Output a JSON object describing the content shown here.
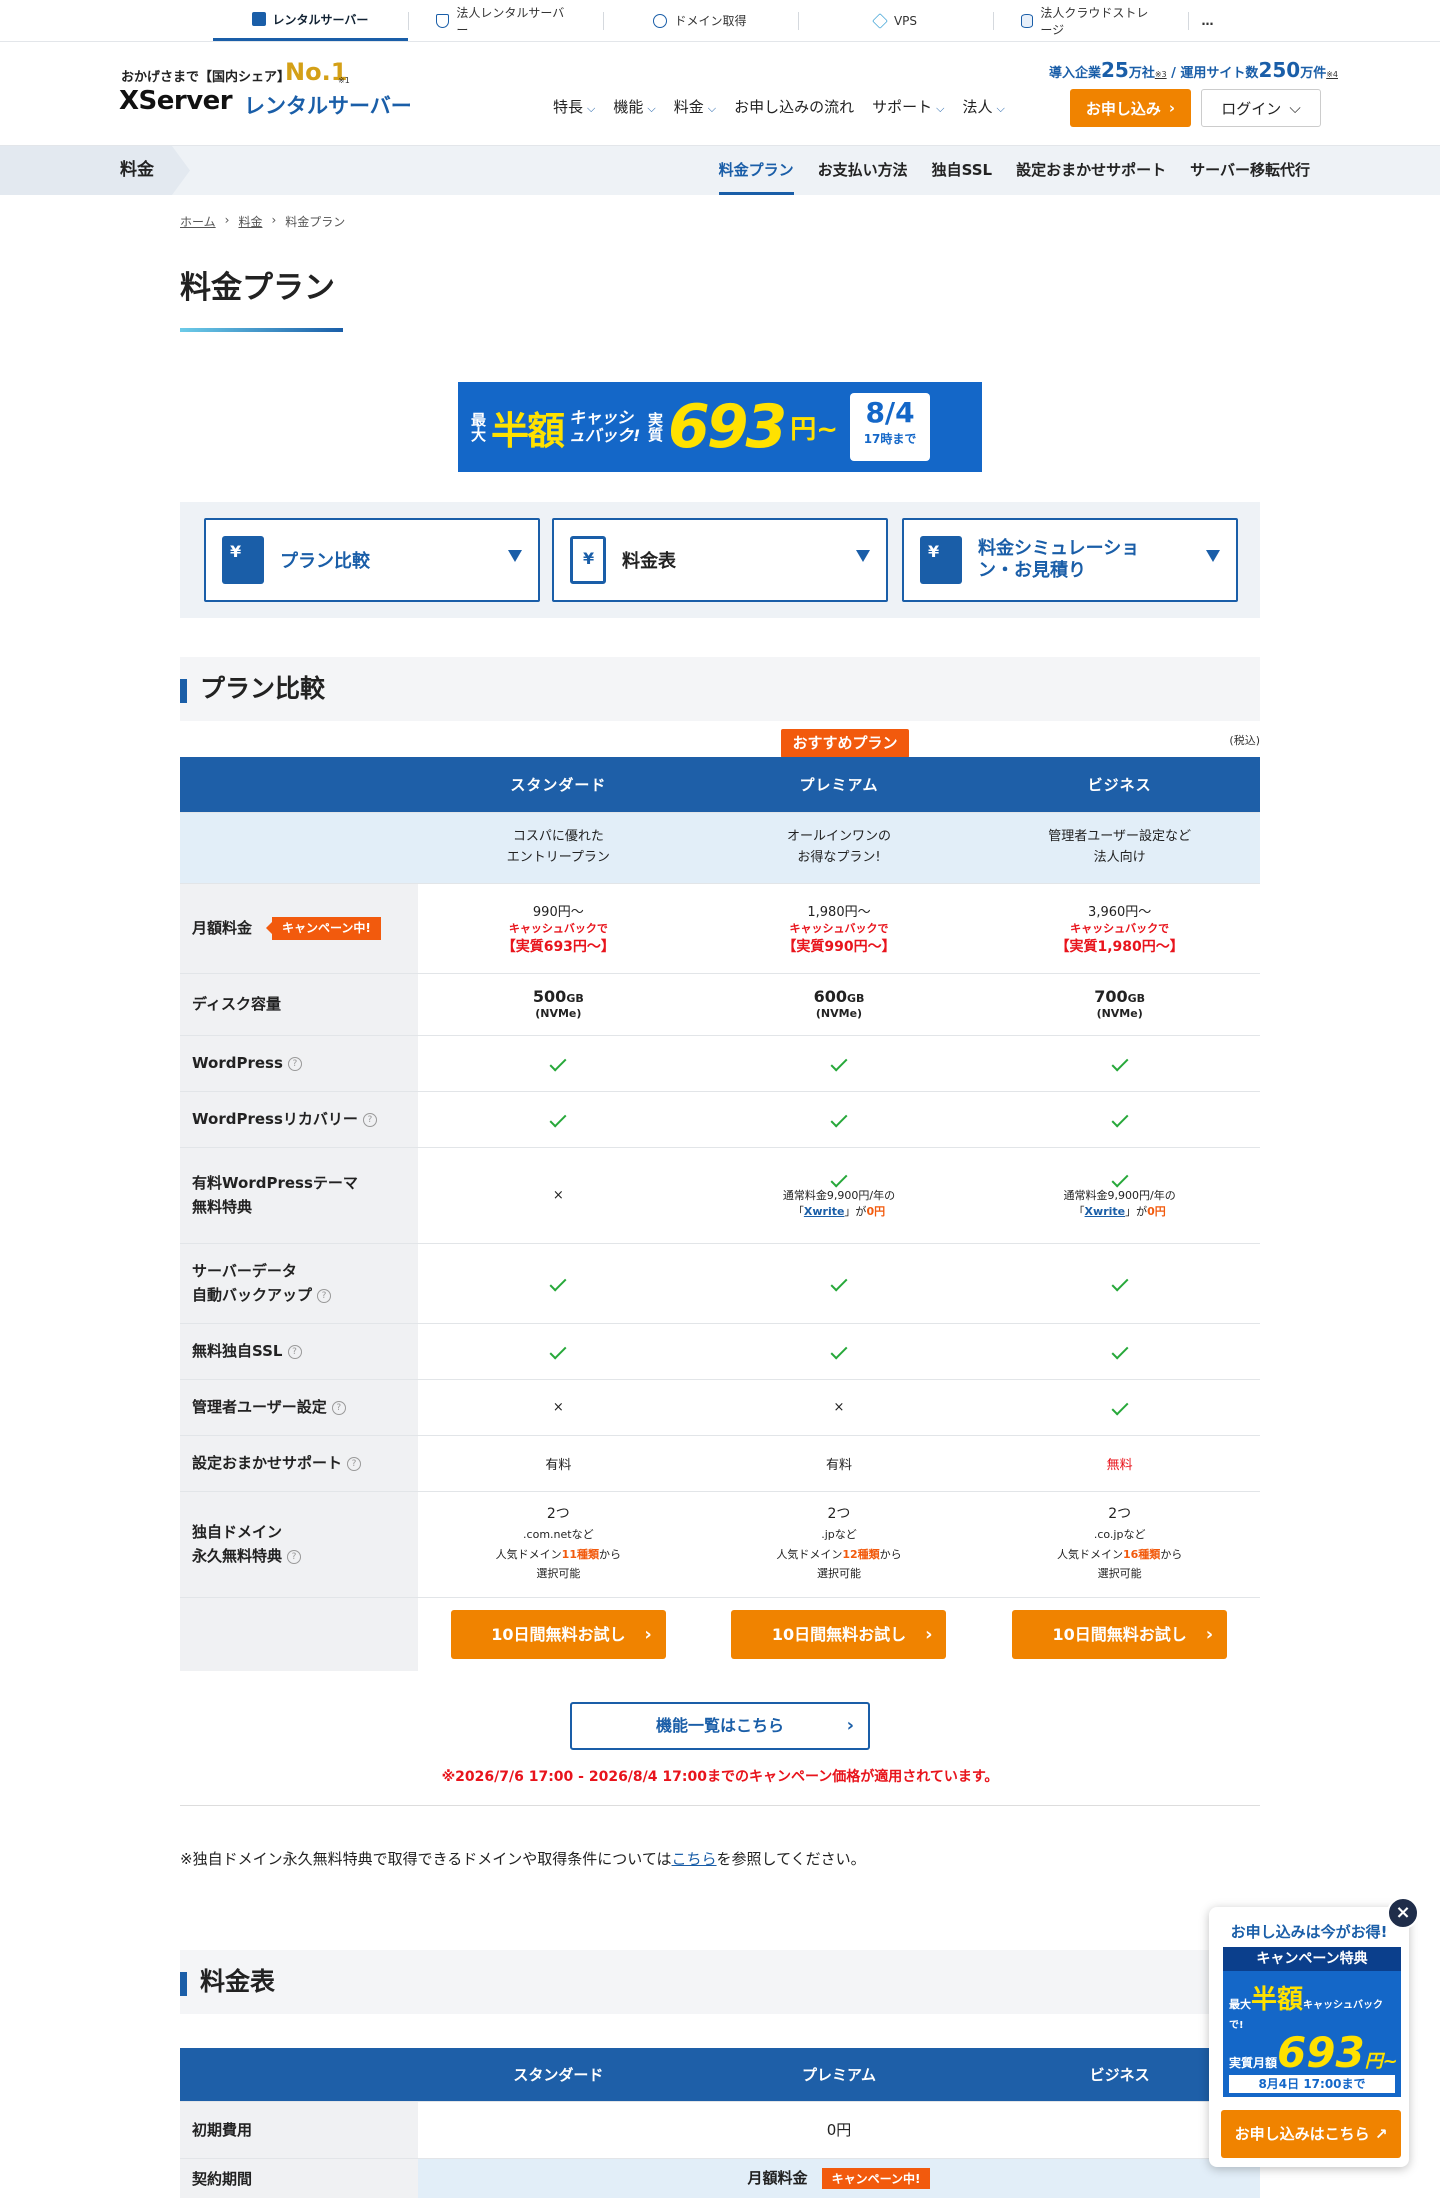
{
  "topbar": {
    "items": [
      {
        "label": "レンタルサーバー",
        "icon": "server-icon"
      },
      {
        "label": "法人レンタルサーバー",
        "icon": "shield-icon"
      },
      {
        "label": "ドメイン取得",
        "icon": "globe-icon"
      },
      {
        "label": "VPS",
        "icon": "cube-icon"
      },
      {
        "label": "法人クラウドストレージ",
        "icon": "database-icon"
      }
    ],
    "more": "…"
  },
  "header": {
    "logo_tagline": "おかげさまで【国内シェア】",
    "logo_no1": "No.1",
    "logo_note": "※1",
    "logo_brand": "XServer",
    "logo_sub": "レンタルサーバー",
    "stats_pre": "導入企業",
    "stats_companies": "25",
    "stats_companies_unit": "万社",
    "stats_note1": "※3",
    "stats_sep": " / 運用サイト数",
    "stats_sites": "250",
    "stats_sites_unit": "万件",
    "stats_note2": "※4",
    "nav": [
      "特長",
      "機能",
      "料金",
      "お申し込みの流れ",
      "サポート",
      "法人"
    ],
    "apply_label": "お申し込み",
    "login_label": "ログイン"
  },
  "subnav": {
    "section": "料金",
    "links": [
      "料金プラン",
      "お支払い方法",
      "独自SSL",
      "設定おまかせサポート",
      "サーバー移転代行"
    ]
  },
  "breadcrumb": [
    "ホーム",
    "料金",
    "料金プラン"
  ],
  "page_title": "料金プラン",
  "banner": {
    "max": "最大",
    "half": "半額",
    "cashback": "キャッシュバック!",
    "real": "実質",
    "price": "693",
    "yen": "円~",
    "date": "8/4",
    "date_sub": "17時まで"
  },
  "tabs": [
    "プラン比較",
    "料金表",
    "料金シミュレーション・お見積り"
  ],
  "compare": {
    "heading": "プラン比較",
    "tax_note": "(税込)",
    "recommend": "おすすめプラン",
    "plans": [
      "スタンダード",
      "プレミアム",
      "ビジネス"
    ],
    "descs": [
      [
        "コスパに優れた",
        "エントリープラン"
      ],
      [
        "オールインワンの",
        "お得なプラン!"
      ],
      [
        "管理者ユーザー設定など",
        "法人向け"
      ]
    ],
    "monthly_label": "月額料金",
    "campaign_badge": "キャンペーン中!",
    "monthly": [
      {
        "base": "990円〜",
        "cb": "キャッシュバックで",
        "real": "【実質693円〜】"
      },
      {
        "base": "1,980円〜",
        "cb": "キャッシュバックで",
        "real": "【実質990円〜】"
      },
      {
        "base": "3,960円〜",
        "cb": "キャッシュバックで",
        "real": "【実質1,980円〜】"
      }
    ],
    "disk_label": "ディスク容量",
    "disk": [
      {
        "size": "500",
        "unit": "GB",
        "type": "(NVMe)"
      },
      {
        "size": "600",
        "unit": "GB",
        "type": "(NVMe)"
      },
      {
        "size": "700",
        "unit": "GB",
        "type": "(NVMe)"
      }
    ],
    "rows": [
      {
        "label": "WordPress",
        "values": [
          "check",
          "check",
          "check"
        ]
      },
      {
        "label": "WordPressリカバリー",
        "values": [
          "check",
          "check",
          "check"
        ]
      }
    ],
    "theme_label1": "有料WordPressテーマ",
    "theme_label2": "無料特典",
    "theme_none": "×",
    "theme_text1": "通常料金9,900円/年の",
    "theme_open": "「",
    "theme_link": "Xwrite",
    "theme_close": "」が",
    "theme_free": "0円",
    "backup_label1": "サーバーデータ",
    "backup_label2": "自動バックアップ",
    "ssl_label": "無料独自SSL",
    "admin_label": "管理者ユーザー設定",
    "admin": [
      "×",
      "×",
      "check"
    ],
    "support_label": "設定おまかせサポート",
    "support": [
      "有料",
      "有料",
      "無料"
    ],
    "domain_label1": "独自ドメイン",
    "domain_label2": "永久無料特典",
    "domains": [
      {
        "count": "2つ",
        "tld": ".com.netなど",
        "pre": "人気ドメイン",
        "num": "11種類",
        "post": "から",
        "sel": "選択可能"
      },
      {
        "count": "2つ",
        "tld": ".jpなど",
        "pre": "人気ドメイン",
        "num": "12種類",
        "post": "から",
        "sel": "選択可能"
      },
      {
        "count": "2つ",
        "tld": ".co.jpなど",
        "pre": "人気ドメイン",
        "num": "16種類",
        "post": "から",
        "sel": "選択可能"
      }
    ],
    "try_label": "10日間無料お試し"
  },
  "feature_button": "機能一覧はこちら",
  "campaign_note": "※2026/7/6 17:00 - 2026/8/4 17:00までのキャンペーン価格が適用されています。",
  "domain_note_pre": "※独自ドメイン永久無料特典で取得できるドメインや取得条件については",
  "domain_note_link": "こちら",
  "domain_note_post": "を参照してください。",
  "price_table": {
    "heading": "料金表",
    "plans": [
      "スタンダード",
      "プレミアム",
      "ビジネス"
    ],
    "initial_label": "初期費用",
    "initial_value": "0円",
    "monthly_label": "月額料金",
    "campaign_badge": "キャンペーン中!",
    "period_label": "契約期間"
  },
  "floating": {
    "title": "お申し込みは今がお得!",
    "header": "キャンペーン特典",
    "line1_pre": "最大",
    "line1_half": "半額",
    "line1_post": "キャッシュバックで!",
    "real": "実質月額",
    "price": "693",
    "yen": "円~",
    "deadline": "8月4日 17:00まで",
    "button": "お申し込みはこちら"
  },
  "colors": {
    "brand": "#1a5ea8",
    "accent": "#f08300",
    "campaign": "#f25a0d",
    "alert": "#e8141c",
    "check": "#27a83a"
  }
}
